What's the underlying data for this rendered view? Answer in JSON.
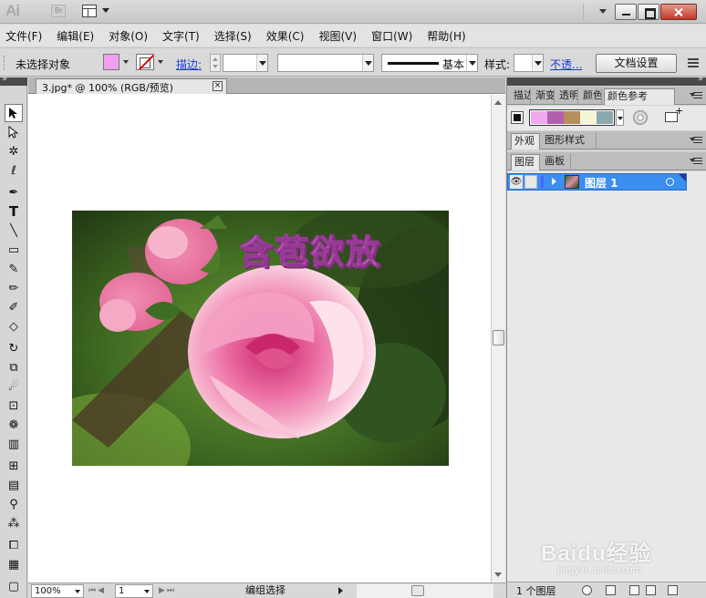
{
  "titlebar": {
    "app_logo": "Ai",
    "bridge_label": "Br"
  },
  "menu": [
    "文件(F)",
    "编辑(E)",
    "对象(O)",
    "文字(T)",
    "选择(S)",
    "效果(C)",
    "视图(V)",
    "窗口(W)",
    "帮助(H)"
  ],
  "control": {
    "selection_status": "未选择对象",
    "fill_color": "#f39ff0",
    "stroke_link": "描边:",
    "stroke_weight": "",
    "variable_width": "",
    "stroke_profile": "基本",
    "style_label": "样式:",
    "opacity_link": "不透...",
    "doc_setup_button": "文档设置"
  },
  "tools": [
    "selection-tool",
    "direct-selection-tool",
    "magic-wand-tool",
    "lasso-tool",
    "pen-tool",
    "type-tool",
    "line-tool",
    "rectangle-tool",
    "paintbrush-tool",
    "pencil-tool",
    "blob-brush-tool",
    "eraser-tool",
    "rotate-tool",
    "scale-tool",
    "warp-tool",
    "free-transform-tool",
    "symbol-sprayer-tool",
    "column-graph-tool",
    "mesh-tool",
    "gradient-tool",
    "eyedropper-tool",
    "blend-tool",
    "artboard-tool",
    "slice-tool"
  ],
  "document": {
    "tab_title": "3.jpg* @ 100% (RGB/预览)",
    "artwork_text": "含苞欲放"
  },
  "status": {
    "zoom": "100%",
    "artboard": "1",
    "status_text": "编组选择"
  },
  "panels": {
    "top_tabs": [
      "描边",
      "渐变",
      "透明",
      "颜色",
      "颜色参考"
    ],
    "color_guide_swatches": [
      "#f0a8ee",
      "#b35fb0",
      "#b58f5c",
      "#f4f4d6",
      "#8aa9ae"
    ],
    "appearance_tabs": [
      "外观",
      "图形样式"
    ],
    "layers_tabs": [
      "图层",
      "画板"
    ],
    "layers": [
      {
        "name": "图层 1",
        "color": "#4a64ff"
      }
    ],
    "layers_count": "1 个图层"
  },
  "watermark": {
    "brand": "Baidu经验",
    "url": "jingyan.baidu.com"
  }
}
